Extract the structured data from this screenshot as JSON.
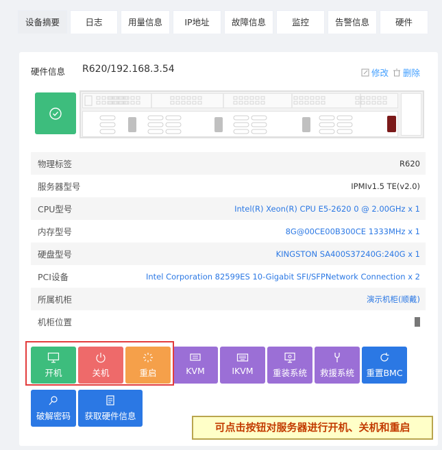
{
  "tabs": [
    {
      "label": "设备摘要",
      "active": true
    },
    {
      "label": "日志"
    },
    {
      "label": "用量信息"
    },
    {
      "label": "IP地址"
    },
    {
      "label": "故障信息"
    },
    {
      "label": "监控"
    },
    {
      "label": "告警信息"
    },
    {
      "label": "硬件"
    }
  ],
  "hardware": {
    "header_label": "硬件信息",
    "title": "R620/192.168.3.54",
    "edit_label": "修改",
    "delete_label": "删除"
  },
  "server": {
    "status_icon": "check-circle-icon",
    "status_color": "#3dbd7d",
    "alert_led_color": "#7b1a1a"
  },
  "info_rows": [
    {
      "key": "物理标签",
      "value": "R620"
    },
    {
      "key": "服务器型号",
      "value": "IPMIv1.5 TE(v2.0)"
    },
    {
      "key": "CPU型号",
      "value": "Intel(R) Xeon(R) CPU E5-2620 0 @ 2.00GHz x 1"
    },
    {
      "key": "内存型号",
      "value": "8G@00CE00B300CE 1333MHz x 1"
    },
    {
      "key": "硬盘型号",
      "value": "KINGSTON SA400S37240G:240G x 1"
    },
    {
      "key": "PCI设备",
      "value": "Intel Corporation 82599ES 10-Gigabit SFI/SFPNetwork Connection x 2"
    },
    {
      "key": "所属机柜",
      "value": "演示机柜(顺戴)"
    },
    {
      "key": "机柜位置",
      "value": ""
    }
  ],
  "actions": {
    "power_on": "开机",
    "power_off": "关机",
    "restart": "重启",
    "kvm": "KVM",
    "ikvm": "IKVM",
    "reinstall": "重装系统",
    "rescue": "救援系统",
    "reset_bmc": "重置BMC",
    "crack_password": "破解密码",
    "get_hw_info": "获取硬件信息"
  },
  "colors": {
    "green": "#3dbd7d",
    "red": "#ee6a6a",
    "orange": "#f5a04a",
    "purple": "#9b6fd6",
    "blue": "#2b78e4"
  },
  "tip": "可点击按钮对服务器进行开机、关机和重启"
}
